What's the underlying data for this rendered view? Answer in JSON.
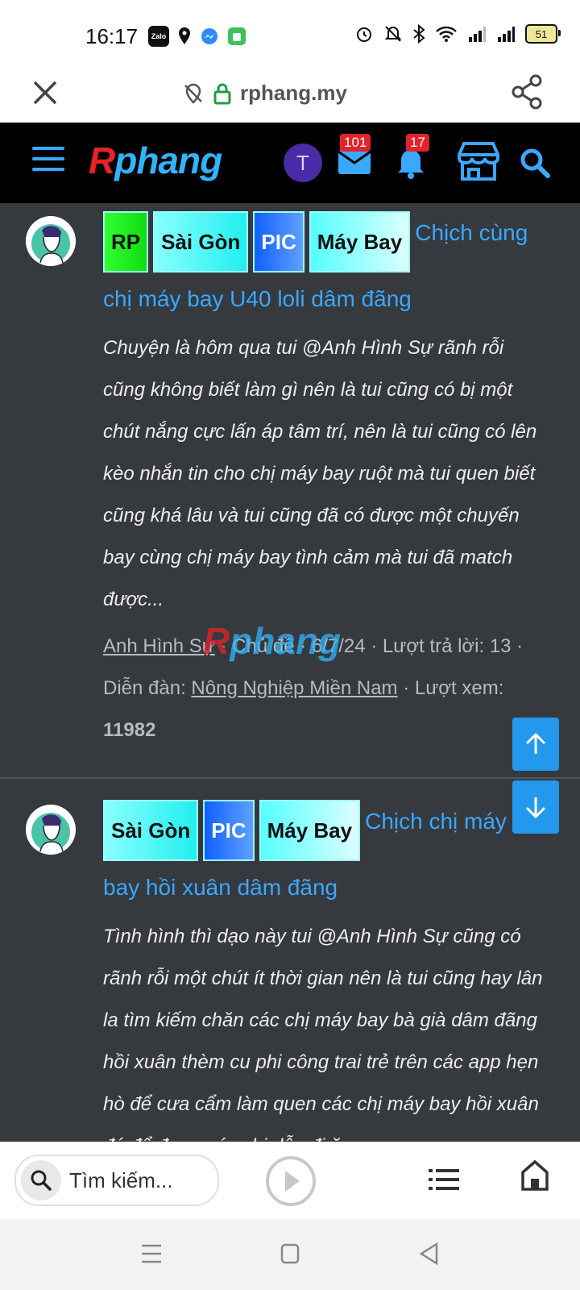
{
  "status_bar": {
    "time": "16:17",
    "app_icons": [
      "Zalo",
      "location-icon",
      "messenger-icon",
      "shop-icon"
    ],
    "battery": "51"
  },
  "url_bar": {
    "url": "rphang.my"
  },
  "site_header": {
    "logo_r": "R",
    "logo_rest": "phang",
    "user_initial": "T",
    "messages_count": "101",
    "notifications_count": "17"
  },
  "threads": [
    {
      "tags": [
        "RP",
        "Sài Gòn",
        "PIC",
        "Máy Bay"
      ],
      "title": "Chịch cùng chị máy bay U40 loli dâm đãng",
      "excerpt": "Chuyện là hôm qua tui @Anh Hình Sự rãnh rỗi cũng không biết làm gì nên là tui cũng có bị một chút nắng cực lấn áp tâm trí, nên là tui cũng có lên kèo nhắn tin cho chị máy bay ruột mà tui quen biết cũng khá lâu và tui cũng đã có được một chuyến bay cùng chị máy bay tình cảm mà tui đã match được...",
      "author": "Anh Hình Sự",
      "meta_topic": "· Chủ đề · 6/7/24 · Lượt trả lời: 13 ·",
      "forum_label": "Diễn đàn:",
      "forum": "Nông Nghiệp Miền Nam",
      "views_label": "· Lượt xem:",
      "views": "11982"
    },
    {
      "tags": [
        "Sài Gòn",
        "PIC",
        "Máy Bay"
      ],
      "title": "Chịch chị máy bay hồi xuân dâm đãng",
      "excerpt": "Tình hình thì dạo này tui @Anh Hình Sự cũng có rãnh rỗi một chút ít thời gian nên là tui cũng hay lân la tìm kiếm chăn các chị máy bay bà già dâm đãng hồi xuân thèm cu phi công trai trẻ trên các app hẹn hò để cưa cẩm làm quen các chị máy bay hồi xuân đó để được các chị dẫn đi ăn..."
    }
  ],
  "bottom_bar": {
    "search_placeholder": "Tìm kiếm..."
  },
  "colors": {
    "accent": "#3aa8ff",
    "background": "#36393e",
    "badge": "#e3232a"
  }
}
